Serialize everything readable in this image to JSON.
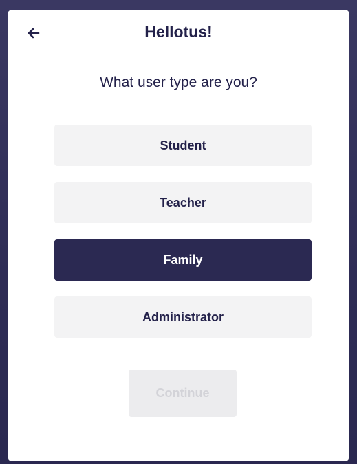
{
  "header": {
    "title": "Hellotus!",
    "back_icon": "arrow-left-icon"
  },
  "prompt": {
    "question": "What user type are you?"
  },
  "user_types": [
    {
      "label": "Student",
      "selected": false
    },
    {
      "label": "Teacher",
      "selected": false
    },
    {
      "label": "Family",
      "selected": true
    },
    {
      "label": "Administrator",
      "selected": false
    }
  ],
  "continue_button": {
    "label": "Continue",
    "disabled": true
  },
  "colors": {
    "brand_dark": "#2b2952",
    "background": "#2f2d56",
    "option_bg": "#f3f3f4",
    "disabled_bg": "#ececee",
    "disabled_text": "#d3d3d8"
  }
}
